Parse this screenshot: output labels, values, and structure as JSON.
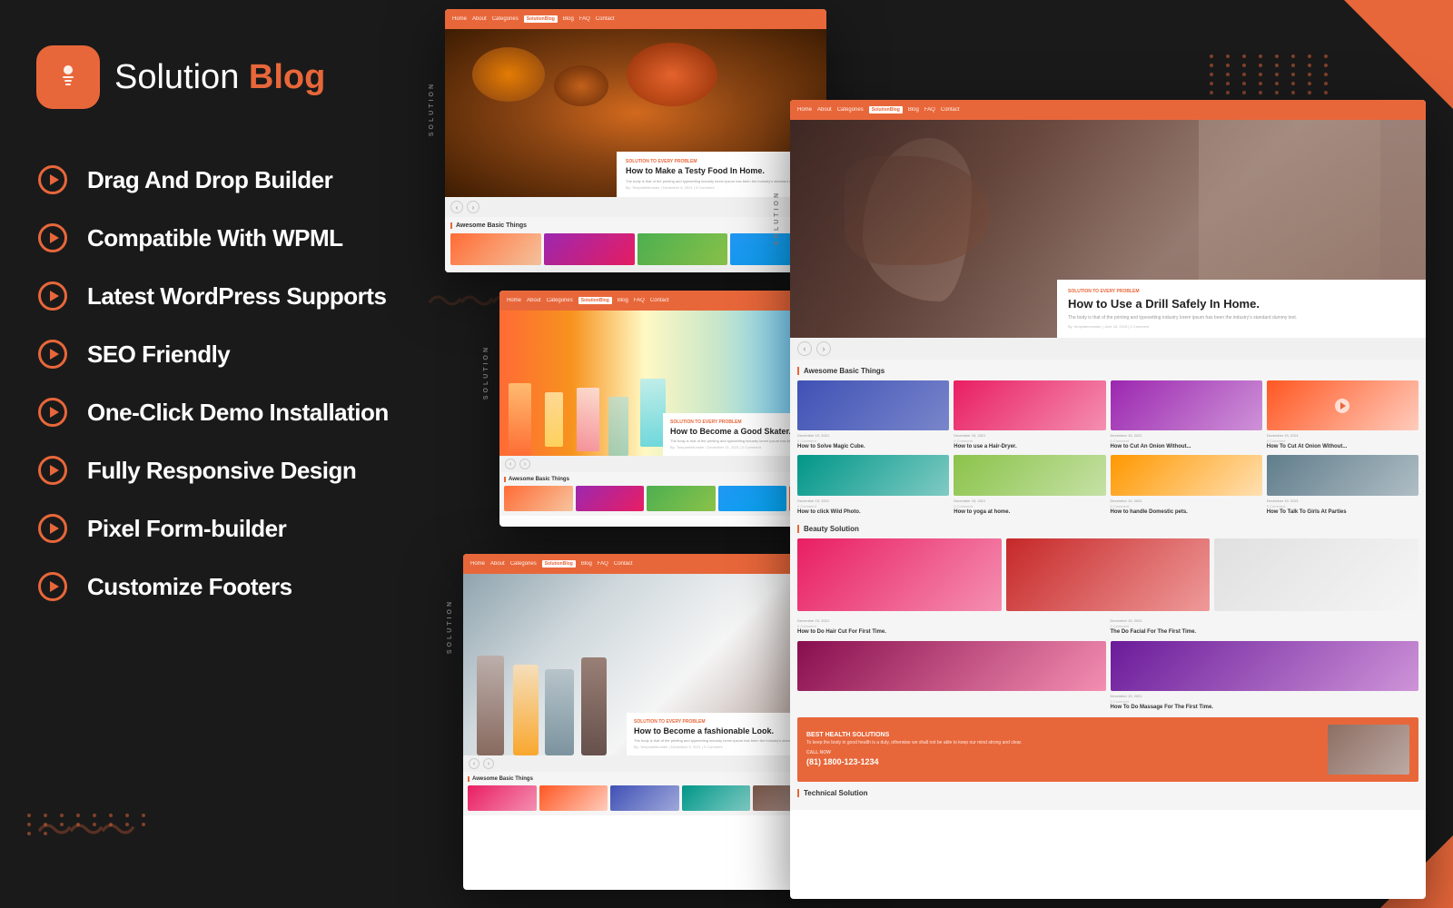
{
  "brand": {
    "name": "Solution Blog",
    "name_part1": "Solution",
    "name_part2": "Blog",
    "icon": "🖐"
  },
  "features": [
    {
      "id": "drag-drop",
      "label": "Drag And Drop Builder"
    },
    {
      "id": "wpml",
      "label": "Compatible With WPML"
    },
    {
      "id": "wordpress",
      "label": "Latest WordPress Supports"
    },
    {
      "id": "seo",
      "label": "SEO Friendly"
    },
    {
      "id": "demo",
      "label": "One-Click Demo Installation"
    },
    {
      "id": "responsive",
      "label": "Fully Responsive Design"
    },
    {
      "id": "pixel",
      "label": "Pixel Form-builder"
    },
    {
      "id": "footer",
      "label": "Customize Footers"
    }
  ],
  "mockups": {
    "nav_links": [
      "Home",
      "About",
      "Categories",
      "SolutionBlog",
      "Blog",
      "FAQ",
      "Contact"
    ],
    "food": {
      "tag": "SOLUTION TO EVERY PROBLEM",
      "title": "How to Make a Testy Food In Home.",
      "desc": "The body is that of the printing and typesetting industry lorem ipsum has been the industry's standard dummy text.",
      "meta": "By: TemplateMonster | December 6, 2021 | 0 Comment"
    },
    "drill": {
      "tag": "SOLUTION TO EVERY PROBLEM",
      "title": "How to Use a Drill Safely In Home.",
      "desc": "The body is that of the printing and typesetting industry lorem ipsum has been the industry's standard dummy text.",
      "meta": "By: templatemonster | June 16, 2019 | 0 Comment"
    },
    "skater": {
      "tag": "SOLUTION TO EVERY PROBLEM",
      "title": "How to Become a Good Skater.",
      "desc": "The body is that of the printing and typesetting industry lorem ipsum has been the industry's standard dummy text.",
      "meta": "By: TemplateMonster | December 21, 2021 | 0 Comment"
    },
    "fashion": {
      "tag": "SOLUTION TO EVERY PROBLEM",
      "title": "How to Become a fashionable Look.",
      "desc": "The body is that of the printing and typesetting industry lorem ipsum has been the industry's standard dummy text.",
      "meta": "By: TemplateMonster | December 9, 2021 | 0 Comment"
    },
    "section_titles": {
      "awesome": "Awesome Basic Things",
      "beauty": "Beauty Solution",
      "technical": "Technical Solution"
    },
    "articles": [
      {
        "date": "December 19, 2021",
        "comments": "0 Comment",
        "title": "How to Solve Magic Cube."
      },
      {
        "date": "December 19, 2021",
        "comments": "0 Comment",
        "title": "How to use a Hair-Dryer."
      },
      {
        "date": "December 19, 2021",
        "comments": "0 Comment",
        "title": "How to Cut An Onion Without..."
      },
      {
        "date": "December 19, 2021",
        "comments": "0 Comment",
        "title": "How to click Wild Photo."
      },
      {
        "date": "December 19, 2021",
        "comments": "0 Comment",
        "title": "How to yoga at home."
      },
      {
        "date": "December 19, 2021",
        "comments": "0 Comment",
        "title": "How to handle Domestic pets."
      },
      {
        "date": "December 19, 2021",
        "comments": "0 Comment",
        "title": "How To Talk To Girls At Parties"
      }
    ],
    "beauty_articles": [
      {
        "date": "December 19, 2021",
        "comments": "0 Comment",
        "title": "How to Do Hair Cut For First Time."
      },
      {
        "date": "December 19, 2021",
        "comments": "0 Comment",
        "title": "The Do Facial For The First Time."
      }
    ],
    "cta": {
      "badge": "BEST HEALTH SOLUTIONS",
      "body": "To keep the body in good health is a duty, otherwise we shall not be able to keep our mind strong and clear.",
      "call_label": "CALL NOW",
      "phone": "(81) 1800-123-1234"
    }
  },
  "colors": {
    "accent": "#e8673a",
    "dark_bg": "#1a1a1a",
    "white": "#ffffff"
  }
}
